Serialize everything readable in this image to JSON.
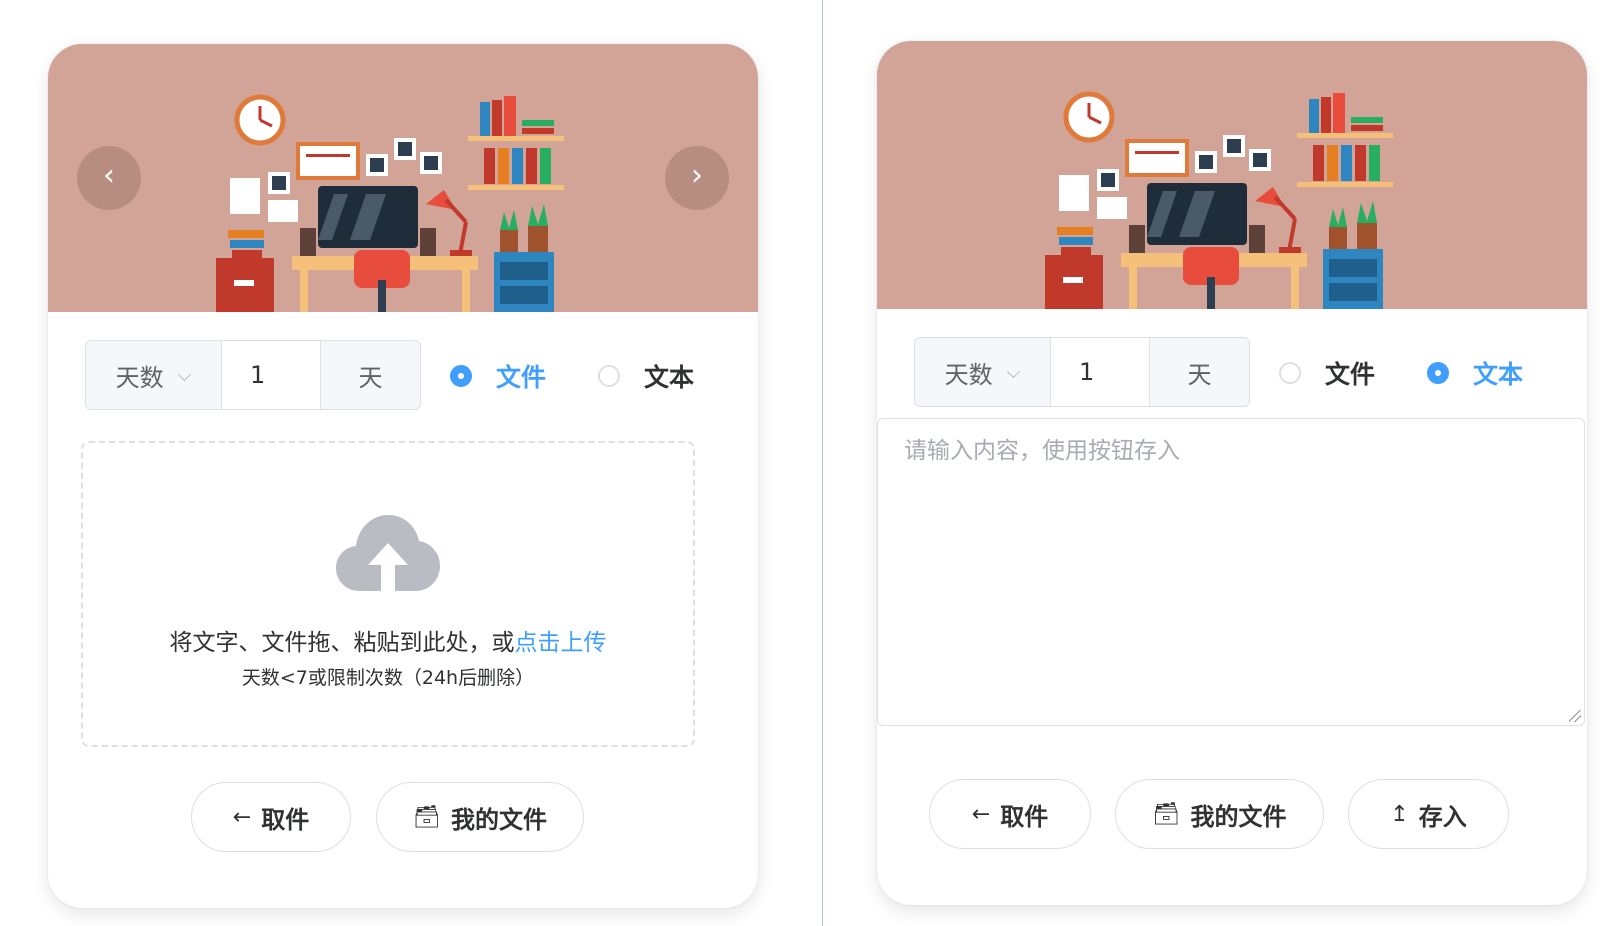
{
  "left_card": {
    "carousel": {
      "prev_icon": "‹",
      "next_icon": "›"
    },
    "expire_select": "天数",
    "expire_value": "1",
    "expire_unit": "天",
    "radio_file": "文件",
    "radio_text": "文本",
    "selected": "文件",
    "upload_text": "将文字、文件拖、粘贴到此处，或",
    "upload_link": "点击上传",
    "upload_tip": "天数<7或限制次数（24h后删除）",
    "cancel_button": "取件",
    "my_files_button": "我的文件"
  },
  "right_card": {
    "expire_select": "天数",
    "expire_value": "1",
    "expire_unit": "天",
    "radio_file": "文件",
    "radio_text": "文本",
    "selected": "文本",
    "textarea_placeholder": "请输入内容，使用按钮存入",
    "cancel_button": "取件",
    "my_files_button": "我的文件",
    "save_button": "存入"
  },
  "icons": {
    "arrow_left": "←",
    "archive": "🗃",
    "upload": "↥",
    "chevron_down": "⌵"
  },
  "colors": {
    "primary": "#409eff",
    "banner_bg": "#d2a498",
    "border": "#dcdfe6"
  }
}
